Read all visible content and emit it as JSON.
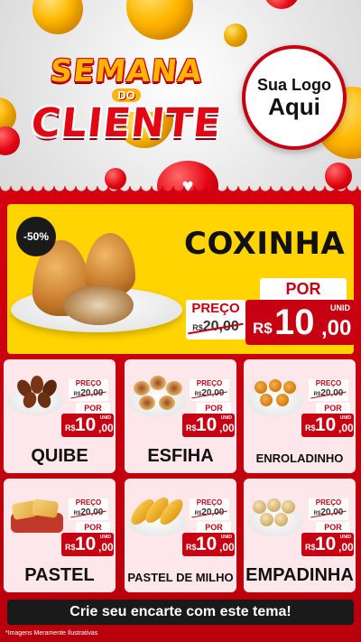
{
  "header": {
    "title_line1": "SEMANA",
    "title_do": "DO",
    "title_line2": "CLIENTE",
    "logo_line1": "Sua Logo",
    "logo_line2": "Aqui"
  },
  "featured": {
    "discount_badge": "-50%",
    "name": "COXINHA",
    "label_preco": "PREÇO",
    "old_currency": "R$",
    "old_int": "20",
    "old_dec": ",00",
    "label_por": "POR",
    "new_currency": "R$",
    "new_int": "10",
    "new_dec": ",00",
    "unit": "UNID"
  },
  "price_labels": {
    "preco": "PREÇO",
    "por": "POR",
    "unid": "UNID",
    "currency": "R$",
    "old_int": "20",
    "old_dec": ",00",
    "new_int": "10",
    "new_dec": ",00"
  },
  "products": [
    {
      "name": "QUIBE"
    },
    {
      "name": "ESFIHA"
    },
    {
      "name": "ENROLADINHO"
    },
    {
      "name": "PASTEL"
    },
    {
      "name": "PASTEL DE MILHO"
    },
    {
      "name": "EMPADINHA"
    }
  ],
  "cta": "Crie seu encarte com este tema!",
  "footnote": "*Imagens Meramente Ilustrativas",
  "colors": {
    "brand_red": "#c70012",
    "feature_yellow": "#ffd400",
    "card_pink": "#fde7ea",
    "title_gold": "#ffb400"
  }
}
